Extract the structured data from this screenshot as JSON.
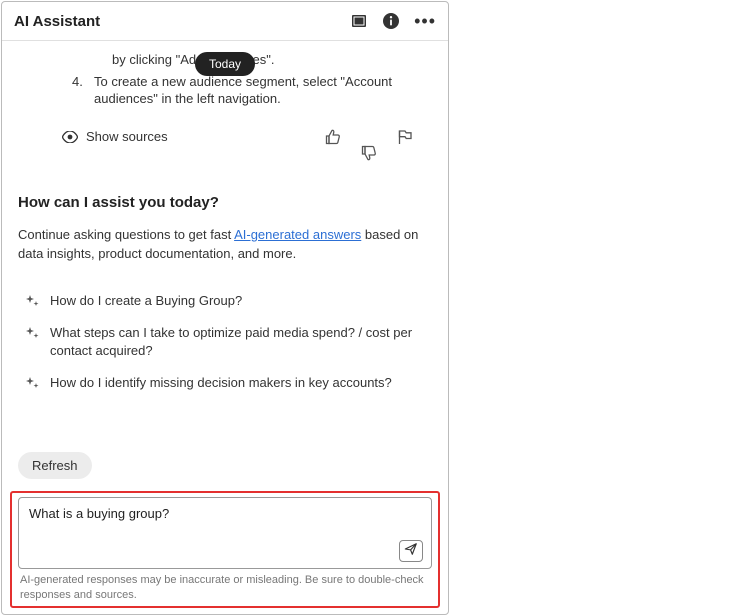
{
  "header": {
    "title": "AI Assistant"
  },
  "today_label": "Today",
  "message": {
    "items": [
      {
        "num": "",
        "indent": true,
        "text": "by clicking \"Add audiences\"."
      },
      {
        "num": "4.",
        "indent": false,
        "text": "To create a new audience segment, select \"Account audiences\" in the left navigation."
      }
    ],
    "show_sources_label": "Show sources"
  },
  "assist": {
    "heading": "How can I assist you today?",
    "intro_prefix": "Continue asking questions to get fast ",
    "intro_link": "AI-generated answers",
    "intro_suffix": " based on data insights, product documentation, and more."
  },
  "suggestions": [
    "How do I create a Buying Group?",
    "What steps can I take to optimize paid media spend? / cost per contact acquired?",
    "How do I identify missing decision makers in key accounts?"
  ],
  "refresh_label": "Refresh",
  "input": {
    "value": "What is a buying group?"
  },
  "disclaimer": "AI-generated responses may be inaccurate or misleading. Be sure to double-check responses and sources."
}
